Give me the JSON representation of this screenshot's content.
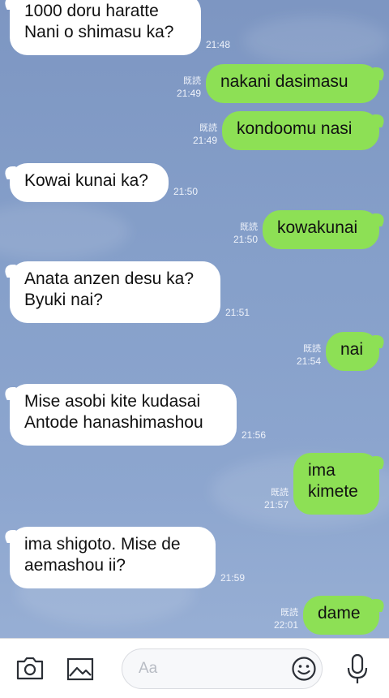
{
  "messages": [
    {
      "side": "in",
      "lines": [
        "1000 doru haratte",
        "Nani o shimasu ka?"
      ],
      "time": "21:48"
    },
    {
      "side": "out",
      "lines": [
        "nakani dasimasu"
      ],
      "read": "既読",
      "time": "21:49"
    },
    {
      "side": "out",
      "lines": [
        "kondoomu nasi"
      ],
      "read": "既読",
      "time": "21:49"
    },
    {
      "side": "in",
      "lines": [
        "Kowai kunai ka?"
      ],
      "time": "21:50"
    },
    {
      "side": "out",
      "lines": [
        "kowakunai"
      ],
      "read": "既読",
      "time": "21:50"
    },
    {
      "side": "in",
      "lines": [
        "Anata anzen desu ka?",
        "Byuki nai?"
      ],
      "time": "21:51"
    },
    {
      "side": "out",
      "lines": [
        "nai"
      ],
      "read": "既読",
      "time": "21:54"
    },
    {
      "side": "in",
      "lines": [
        "Mise asobi kite kudasai",
        "Antode hanashimashou"
      ],
      "time": "21:56"
    },
    {
      "side": "out",
      "lines": [
        "ima",
        "kimete"
      ],
      "read": "既読",
      "time": "21:57"
    },
    {
      "side": "in",
      "lines": [
        "ima shigoto. Mise de",
        "aemashou ii?"
      ],
      "time": "21:59"
    },
    {
      "side": "out",
      "lines": [
        "dame"
      ],
      "read": "既読",
      "time": "22:01"
    }
  ],
  "input": {
    "placeholder": "Aa",
    "icons": [
      "camera-icon",
      "image-icon",
      "emoji-icon",
      "microphone-icon"
    ]
  },
  "colors": {
    "background": "#86a0ca",
    "incoming_bubble": "#ffffff",
    "outgoing_bubble": "#8de055",
    "meta_text": "#eef2fa"
  }
}
